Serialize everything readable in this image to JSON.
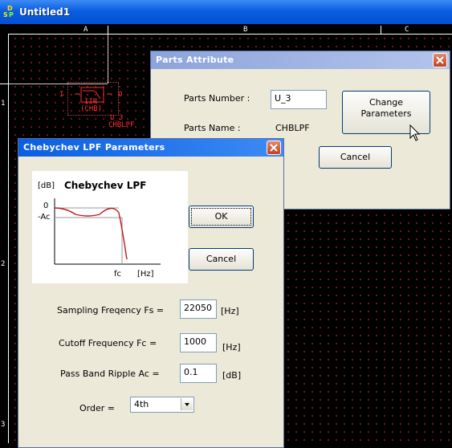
{
  "window": {
    "title": "Untitled1",
    "icon_letters": [
      "D",
      "S",
      "P"
    ],
    "icon": "dsp-app-icon"
  },
  "rulers": {
    "columns": [
      "A",
      "B",
      "C"
    ],
    "rows": [
      "1",
      "2",
      "3"
    ]
  },
  "component": {
    "left_label": "I",
    "right_label": "O",
    "block_label": "IIR",
    "block_sub": "(CHB)",
    "ref_number": "U_3",
    "part_name": "CHBLPF"
  },
  "parts_attribute": {
    "title": "Parts Attribute",
    "parts_number_label": "Parts Number :",
    "parts_number_value": "U_3",
    "parts_name_label": "Parts Name :",
    "parts_name_value": "CHBLPF",
    "change_parameters_label": "Change\nParameters",
    "cancel_label": "Cancel"
  },
  "chebychev": {
    "title": "Chebychev LPF Parameters",
    "graph": {
      "title": "Chebychev LPF",
      "y_unit": "[dB]",
      "y_zero": "0",
      "y_ripple": "-Ac",
      "x_cutoff": "fc",
      "x_unit": "[Hz]"
    },
    "ok_label": "OK",
    "cancel_label": "Cancel",
    "fields": {
      "sampling": {
        "label": "Sampling Freqency Fs =",
        "value": "22050",
        "unit": "[Hz]"
      },
      "cutoff": {
        "label": "Cutoff Frequency Fc =",
        "value": "1000",
        "unit": "[Hz]"
      },
      "ripple": {
        "label": "Pass Band Ripple Ac =",
        "value": "0.1",
        "unit": "[dB]"
      },
      "order": {
        "label": "Order =",
        "value": "4th"
      }
    }
  },
  "colors": {
    "title_blue": "#0a5ee0",
    "dialog_face": "#ece9d8",
    "schematic_red": "#ff3030",
    "close_red": "#c2401e"
  }
}
